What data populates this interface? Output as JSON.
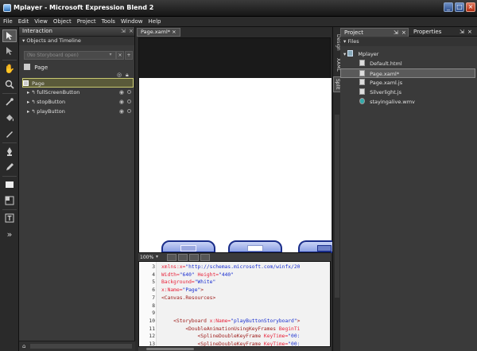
{
  "window": {
    "title": "Mplayer - Microsoft Expression Blend 2",
    "buttons": [
      "_",
      "□",
      "×"
    ]
  },
  "menu": [
    "File",
    "Edit",
    "View",
    "Object",
    "Project",
    "Tools",
    "Window",
    "Help"
  ],
  "interaction": {
    "panel_title": "Interaction",
    "objects_header": "Objects and Timeline",
    "storyboard": "(No Storyboard open)",
    "storyboard_close": "×",
    "storyboard_add": "+",
    "scope": "Page",
    "tree": [
      {
        "label": "Page"
      },
      {
        "label": "fullScreenButton"
      },
      {
        "label": "stopButton"
      },
      {
        "label": "playButton"
      }
    ]
  },
  "document": {
    "tab": "Page.xaml*",
    "zoom": "100%",
    "side_tabs": [
      "Design",
      "XAML",
      "Split"
    ]
  },
  "code": {
    "line_numbers": [
      "3",
      "4",
      "5",
      "6",
      "7",
      "8",
      "9",
      "10",
      "11",
      "12",
      "13"
    ],
    "lines": [
      [
        {
          "t": "xmlns:x=",
          "c": "attr"
        },
        {
          "t": "\"http://schemas.microsoft.com/winfx/20",
          "c": "str"
        }
      ],
      [
        {
          "t": "Width=",
          "c": "attr"
        },
        {
          "t": "\"640\"",
          "c": "str"
        },
        {
          "t": " Height=",
          "c": "attr"
        },
        {
          "t": "\"440\"",
          "c": "str"
        }
      ],
      [
        {
          "t": "Background=",
          "c": "attr"
        },
        {
          "t": "\"White\"",
          "c": "str"
        }
      ],
      [
        {
          "t": "x:Name=",
          "c": "attr"
        },
        {
          "t": "\"Page\"",
          "c": "str"
        },
        {
          "t": ">",
          "c": "tag"
        }
      ],
      [
        {
          "t": "<Canvas.Resources>",
          "c": "tag"
        }
      ],
      [
        {
          "t": "",
          "c": "tag"
        }
      ],
      [
        {
          "t": "",
          "c": "tag"
        }
      ],
      [
        {
          "t": "    <Storyboard ",
          "c": "tag"
        },
        {
          "t": "x:Name=",
          "c": "attr"
        },
        {
          "t": "\"playButtonStoryboard\"",
          "c": "str"
        },
        {
          "t": ">",
          "c": "tag"
        }
      ],
      [
        {
          "t": "        <DoubleAnimationUsingKeyFrames ",
          "c": "tag"
        },
        {
          "t": "BeginTi",
          "c": "attr"
        }
      ],
      [
        {
          "t": "            <SplineDoubleKeyFrame ",
          "c": "tag"
        },
        {
          "t": "KeyTime=",
          "c": "attr"
        },
        {
          "t": "\"00:",
          "c": "str"
        }
      ],
      [
        {
          "t": "            <SplineDoubleKeyFrame ",
          "c": "tag"
        },
        {
          "t": "KeyTime=",
          "c": "attr"
        },
        {
          "t": "\"00:",
          "c": "str"
        }
      ]
    ]
  },
  "project": {
    "tabs": [
      "Project",
      "Properties"
    ],
    "files_header": "Files",
    "root": "Mplayer",
    "files": [
      {
        "name": "Default.html",
        "type": "html"
      },
      {
        "name": "Page.xaml*",
        "type": "xaml"
      },
      {
        "name": "Page.xaml.js",
        "type": "js"
      },
      {
        "name": "Silverlight.js",
        "type": "js"
      },
      {
        "name": "stayingalive.wmv",
        "type": "wmv"
      }
    ]
  }
}
